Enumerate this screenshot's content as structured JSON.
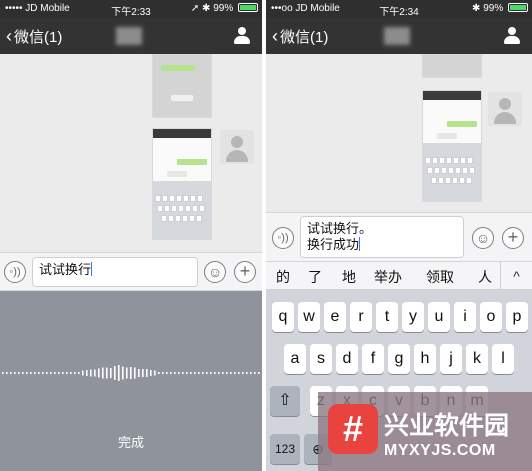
{
  "left_screen": {
    "status": {
      "carrier": "••••• JD Mobile",
      "wifi_icon": "wifi-icon",
      "time": "下午2:33",
      "battery": "99%",
      "battery_level": 0.99
    },
    "nav": {
      "back_label": "微信(1)"
    },
    "input": {
      "text": "试试换行"
    },
    "voice_panel": {
      "done_label": "完成"
    }
  },
  "right_screen": {
    "status": {
      "carrier": "•••oo JD Mobile",
      "wifi_icon": "wifi-icon",
      "time": "下午2:34",
      "battery": "99%",
      "battery_level": 0.99
    },
    "nav": {
      "back_label": "微信(1)"
    },
    "input": {
      "line1": "试试换行。",
      "line2": "换行成功"
    },
    "candidates": [
      "的",
      "了",
      "地",
      "举办",
      "领取",
      "人"
    ],
    "keyboard": {
      "row1": [
        "q",
        "w",
        "e",
        "r",
        "t",
        "y",
        "u",
        "i",
        "o",
        "p"
      ],
      "row2": [
        "a",
        "s",
        "d",
        "f",
        "g",
        "h",
        "j",
        "k",
        "l"
      ],
      "row3": [
        "z",
        "x",
        "c",
        "v",
        "b",
        "n",
        "m"
      ],
      "num_label": "123"
    }
  },
  "watermark": {
    "name": "兴业软件园",
    "url": "MYXYJS.COM",
    "logo_glyph": "#"
  },
  "colors": {
    "nav": "#333333",
    "chat_bg": "#ebebeb",
    "voice_panel": "#8f949c",
    "keyboard": "#d1d5db",
    "accent": "#2d7cf6",
    "watermark_logo": "#e8433e"
  }
}
